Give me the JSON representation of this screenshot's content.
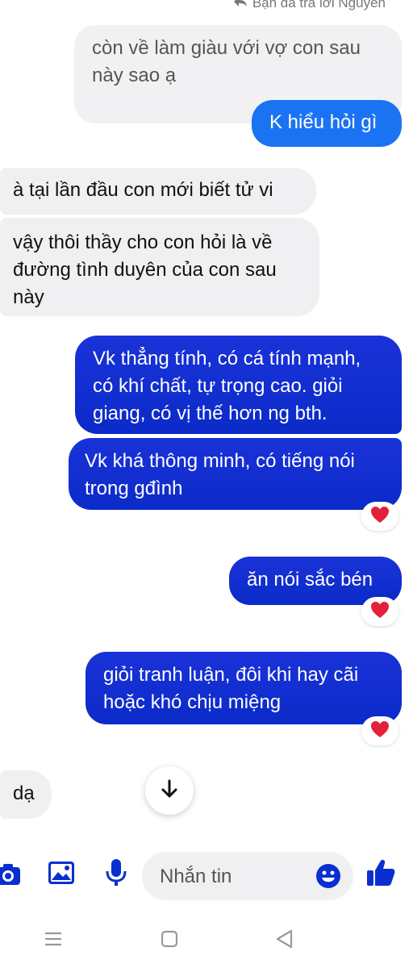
{
  "reply_hint": "Bạn đã trả lời Nguyen",
  "messages": [
    {
      "id": "quoted",
      "text": "còn về làm giàu với vợ con sau này sao ạ"
    },
    {
      "id": "sent1",
      "text": "K hiểu hỏi gì"
    },
    {
      "id": "in1",
      "text": "à tại lần đầu con mới biết tử vi"
    },
    {
      "id": "in2",
      "text": "vậy thôi thầy cho con hỏi là về đường tình duyên của con sau này"
    },
    {
      "id": "out1",
      "text": "Vk thẳng tính, có cá tính mạnh, có khí chất, tự trọng cao. giỏi giang, có vị thế hơn ng bth."
    },
    {
      "id": "out2",
      "text": "Vk khá thông minh, có tiếng nói trong gđình"
    },
    {
      "id": "out3",
      "text": "ăn nói sắc bén"
    },
    {
      "id": "out4",
      "text": "giỏi tranh luận, đôi khi hay cãi hoặc khó chịu miệng"
    },
    {
      "id": "in3",
      "text": "dạ"
    }
  ],
  "reactions": {
    "emoji": "heart",
    "color": "#e3213b"
  },
  "composer": {
    "placeholder": "Nhắn tin"
  },
  "colors": {
    "outgoing": "#0b2bc9",
    "sent_blue": "#1a73f2",
    "icons": "#0a2fd0",
    "incoming": "#f0f0f2"
  }
}
